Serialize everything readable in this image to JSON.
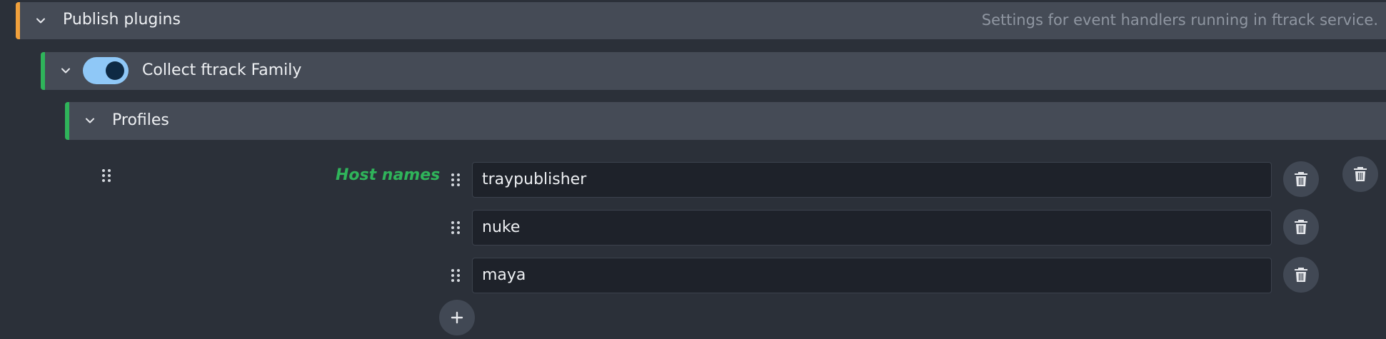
{
  "publish_plugins": {
    "title": "Publish plugins",
    "description": "Settings for event handlers running in ftrack service.",
    "accent_color": "#f0a03c"
  },
  "collect_family": {
    "title": "Collect ftrack Family",
    "enabled": true,
    "accent_color": "#2fb45a"
  },
  "profiles": {
    "title": "Profiles",
    "accent_color": "#2fb45a"
  },
  "host_names": {
    "label": "Host names",
    "label_color": "#2fb45a",
    "items": [
      {
        "value": "traypublisher"
      },
      {
        "value": "nuke"
      },
      {
        "value": "maya"
      }
    ]
  },
  "icons": {
    "collapse": "chevron-down-icon",
    "drag": "drag-handle-icon",
    "delete": "trash-icon",
    "add": "plus-icon"
  }
}
